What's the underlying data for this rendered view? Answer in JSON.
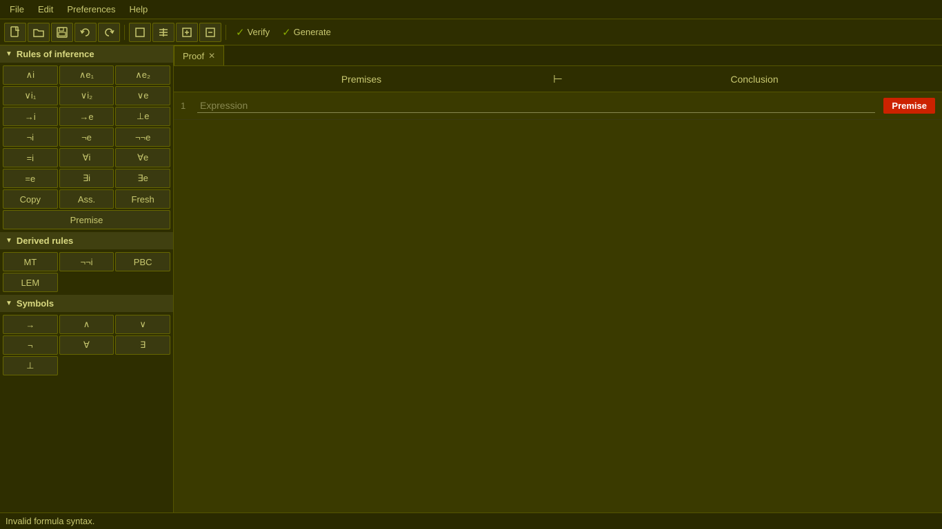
{
  "menubar": {
    "items": [
      "File",
      "Edit",
      "Preferences",
      "Help"
    ]
  },
  "toolbar": {
    "buttons": [
      {
        "name": "new-file-btn",
        "icon": "📄",
        "label": "New"
      },
      {
        "name": "open-btn",
        "icon": "📂",
        "label": "Open"
      },
      {
        "name": "save-btn",
        "icon": "💾",
        "label": "Save"
      },
      {
        "name": "undo-btn",
        "icon": "↩",
        "label": "Undo"
      },
      {
        "name": "redo-btn",
        "icon": "↪",
        "label": "Redo"
      },
      {
        "name": "sep1",
        "type": "sep"
      },
      {
        "name": "box-btn",
        "icon": "□",
        "label": "Box"
      },
      {
        "name": "rules-btn",
        "icon": "☰",
        "label": "Rules"
      },
      {
        "name": "add-btn",
        "icon": "＋",
        "label": "Add"
      },
      {
        "name": "remove-btn",
        "icon": "－",
        "label": "Remove"
      }
    ],
    "verify_label": "Verify",
    "generate_label": "Generate",
    "check": "✓"
  },
  "sidebar": {
    "rules_inference_label": "Rules of inference",
    "rules_inference_arrow": "▼",
    "rules": [
      {
        "id": "and-i",
        "label": "∧i"
      },
      {
        "id": "and-e1",
        "label": "∧e₁"
      },
      {
        "id": "and-e2",
        "label": "∧e₂"
      },
      {
        "id": "or-i1",
        "label": "∨i₁"
      },
      {
        "id": "or-i2",
        "label": "∨i₂"
      },
      {
        "id": "or-e",
        "label": "∨e"
      },
      {
        "id": "impl-i",
        "label": "→i"
      },
      {
        "id": "impl-e",
        "label": "→e"
      },
      {
        "id": "bot-e",
        "label": "⊥e"
      },
      {
        "id": "neg-i",
        "label": "¬i"
      },
      {
        "id": "neg-e",
        "label": "¬e"
      },
      {
        "id": "neg-neg-e",
        "label": "¬¬e"
      },
      {
        "id": "eq-i",
        "label": "=i"
      },
      {
        "id": "forall-i",
        "label": "∀i"
      },
      {
        "id": "forall-e",
        "label": "∀e"
      },
      {
        "id": "eq-e",
        "label": "=e"
      },
      {
        "id": "exists-i",
        "label": "∃i"
      },
      {
        "id": "exists-e",
        "label": "∃e"
      },
      {
        "id": "copy",
        "label": "Copy"
      },
      {
        "id": "ass",
        "label": "Ass."
      },
      {
        "id": "fresh",
        "label": "Fresh"
      }
    ],
    "premise_label": "Premise",
    "derived_rules_label": "Derived rules",
    "derived_rules_arrow": "▼",
    "derived_rules": [
      {
        "id": "mt",
        "label": "MT"
      },
      {
        "id": "neg-neg-i",
        "label": "¬¬i"
      },
      {
        "id": "pbc",
        "label": "PBC"
      },
      {
        "id": "lem",
        "label": "LEM"
      }
    ],
    "symbols_label": "Symbols",
    "symbols_arrow": "▼",
    "symbols": [
      {
        "id": "sym-impl",
        "label": "→"
      },
      {
        "id": "sym-and",
        "label": "∧"
      },
      {
        "id": "sym-or",
        "label": "∨"
      },
      {
        "id": "sym-neg",
        "label": "¬"
      },
      {
        "id": "sym-forall",
        "label": "∀"
      },
      {
        "id": "sym-exists",
        "label": "∃"
      },
      {
        "id": "sym-bot",
        "label": "⊥"
      }
    ]
  },
  "tabs": [
    {
      "id": "proof-tab",
      "label": "Proof",
      "active": true,
      "closable": true
    }
  ],
  "proof": {
    "premises_label": "Premises",
    "turnstile": "⊢",
    "conclusion_label": "Conclusion",
    "rows": [
      {
        "num": "1",
        "expression_placeholder": "Expression",
        "justify_label": "Premise"
      }
    ]
  },
  "statusbar": {
    "message": "Invalid formula syntax."
  }
}
